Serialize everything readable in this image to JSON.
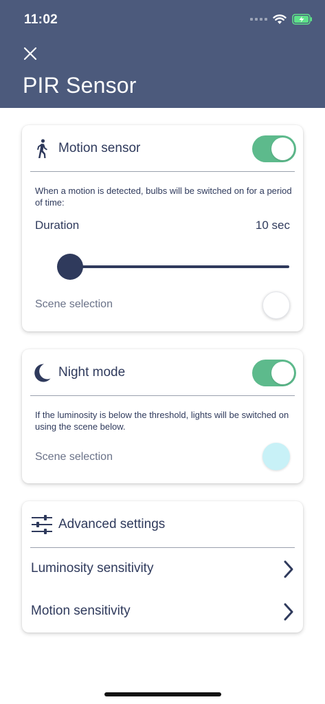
{
  "status_bar": {
    "time": "11:02"
  },
  "header": {
    "title": "PIR Sensor",
    "close_icon": "close-icon"
  },
  "motion_card": {
    "title": "Motion sensor",
    "icon": "walking-person-icon",
    "enabled": true,
    "description": "When a motion is detected, bulbs will be switched on for a period of time:",
    "duration_label": "Duration",
    "duration_value": "10 sec",
    "scene_label": "Scene selection",
    "scene_color": "#ffffff"
  },
  "night_card": {
    "title": "Night mode",
    "icon": "moon-icon",
    "enabled": true,
    "description": "If the luminosity is below the threshold, lights will be switched on using the scene below.",
    "scene_label": "Scene selection",
    "scene_color": "#c8f1f7"
  },
  "advanced_card": {
    "title": "Advanced settings",
    "icon": "sliders-icon",
    "items": [
      {
        "label": "Luminosity sensitivity"
      },
      {
        "label": "Motion sensitivity"
      }
    ]
  },
  "colors": {
    "header_bg": "#4c5a7c",
    "toggle_on": "#5dba8c",
    "text_primary": "#2f3a5c"
  }
}
